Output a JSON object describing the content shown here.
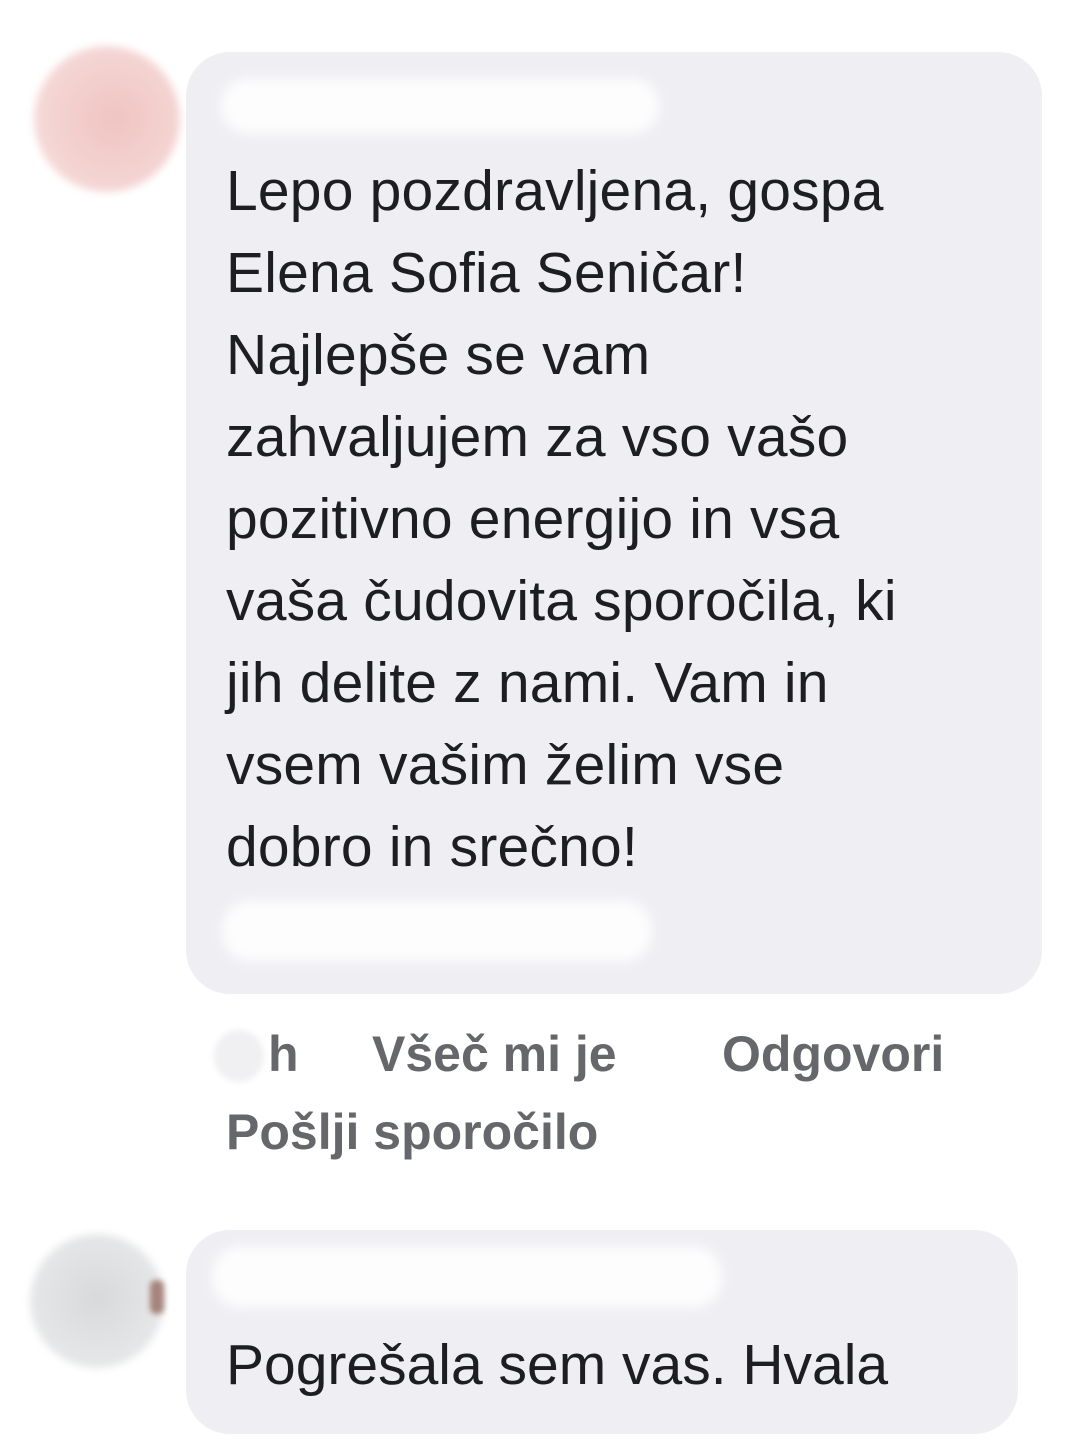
{
  "comments": [
    {
      "text": "Lepo pozdravljena, gospa\nElena Sofia Seničar!\nNajlepše se vam\nzahvaljujem za vso vašo\npozitivno energijo in vsa\nvaša čudovita sporočila, ki\njih delite z nami. Vam in\nvsem vašim želim vse\ndobro in srečno!",
      "time_suffix": "h",
      "actions": {
        "like": "Všeč mi je",
        "reply": "Odgovori",
        "message": "Pošlji sporočilo"
      }
    },
    {
      "text": "Pogrešala sem vas. Hvala"
    }
  ],
  "colors": {
    "bubble_background": "#eeeef3",
    "text": "#1c1e21",
    "action_link": "#65676b"
  }
}
